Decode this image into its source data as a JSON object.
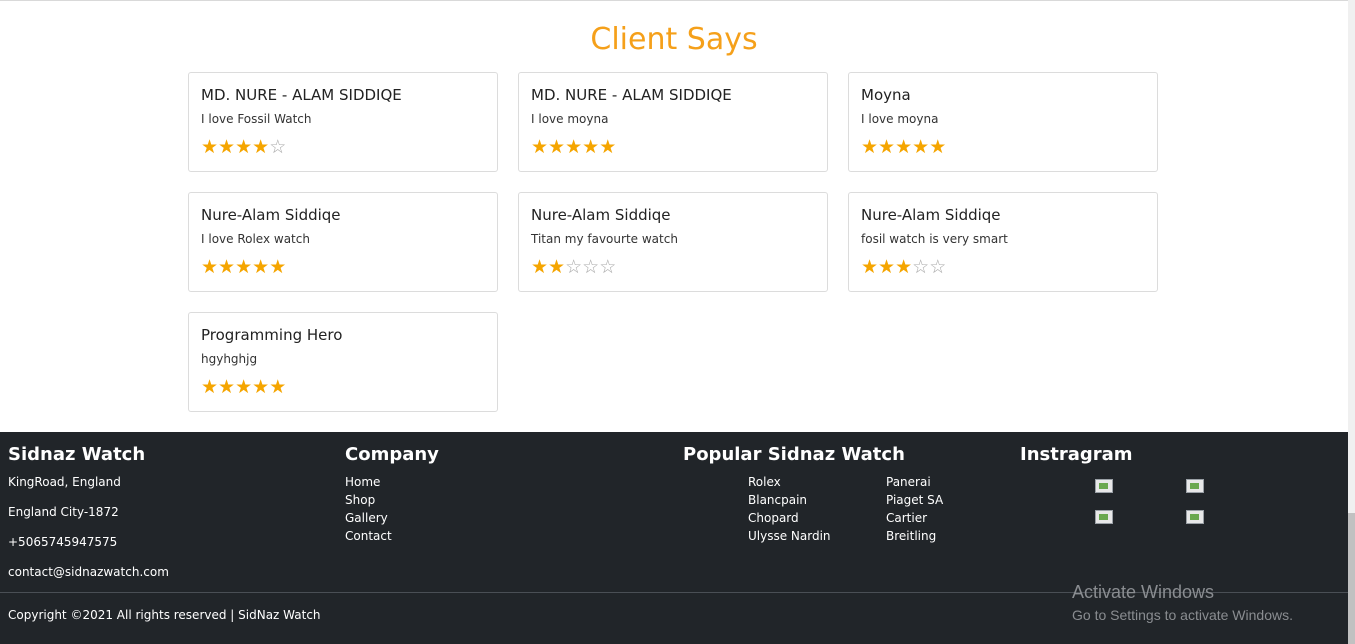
{
  "section_title": "Client Says",
  "reviews": [
    {
      "name": "MD. NURE - ALAM SIDDIQE",
      "text": "I love Fossil Watch",
      "rating": 4
    },
    {
      "name": "MD. NURE - ALAM SIDDIQE",
      "text": "I love moyna",
      "rating": 5
    },
    {
      "name": "Moyna",
      "text": "I love moyna",
      "rating": 5
    },
    {
      "name": "Nure-Alam Siddiqe",
      "text": "I love Rolex watch",
      "rating": 5
    },
    {
      "name": "Nure-Alam Siddiqe",
      "text": "Titan my favourte watch",
      "rating": 2
    },
    {
      "name": "Nure-Alam Siddiqe",
      "text": "fosil watch is very smart",
      "rating": 3
    },
    {
      "name": "Programming Hero",
      "text": "hgyhghjg",
      "rating": 5
    }
  ],
  "footer": {
    "brand": {
      "title": "Sidnaz Watch",
      "lines": [
        "KingRoad, England",
        "England City-1872",
        "+5065745947575",
        "contact@sidnazwatch.com"
      ]
    },
    "company": {
      "title": "Company",
      "links": [
        "Home",
        "Shop",
        "Gallery",
        "Contact"
      ]
    },
    "popular": {
      "title": "Popular Sidnaz Watch",
      "col1": [
        "Rolex",
        "Blancpain",
        "Chopard",
        "Ulysse Nardin"
      ],
      "col2": [
        "Panerai",
        "Piaget SA",
        "Cartier",
        "Breitling"
      ]
    },
    "instagram": {
      "title": "Instragram",
      "images": [
        "broken-image-icon",
        "broken-image-icon",
        "broken-image-icon",
        "broken-image-icon"
      ]
    },
    "copyright": "Copyright ©2021 All rights reserved | SidNaz Watch"
  },
  "windows_watermark": {
    "line1": "Activate Windows",
    "line2": "Go to Settings to activate Windows."
  },
  "colors": {
    "accent": "#f5a01a",
    "star": "#f5a500",
    "footer_bg": "#212529"
  }
}
